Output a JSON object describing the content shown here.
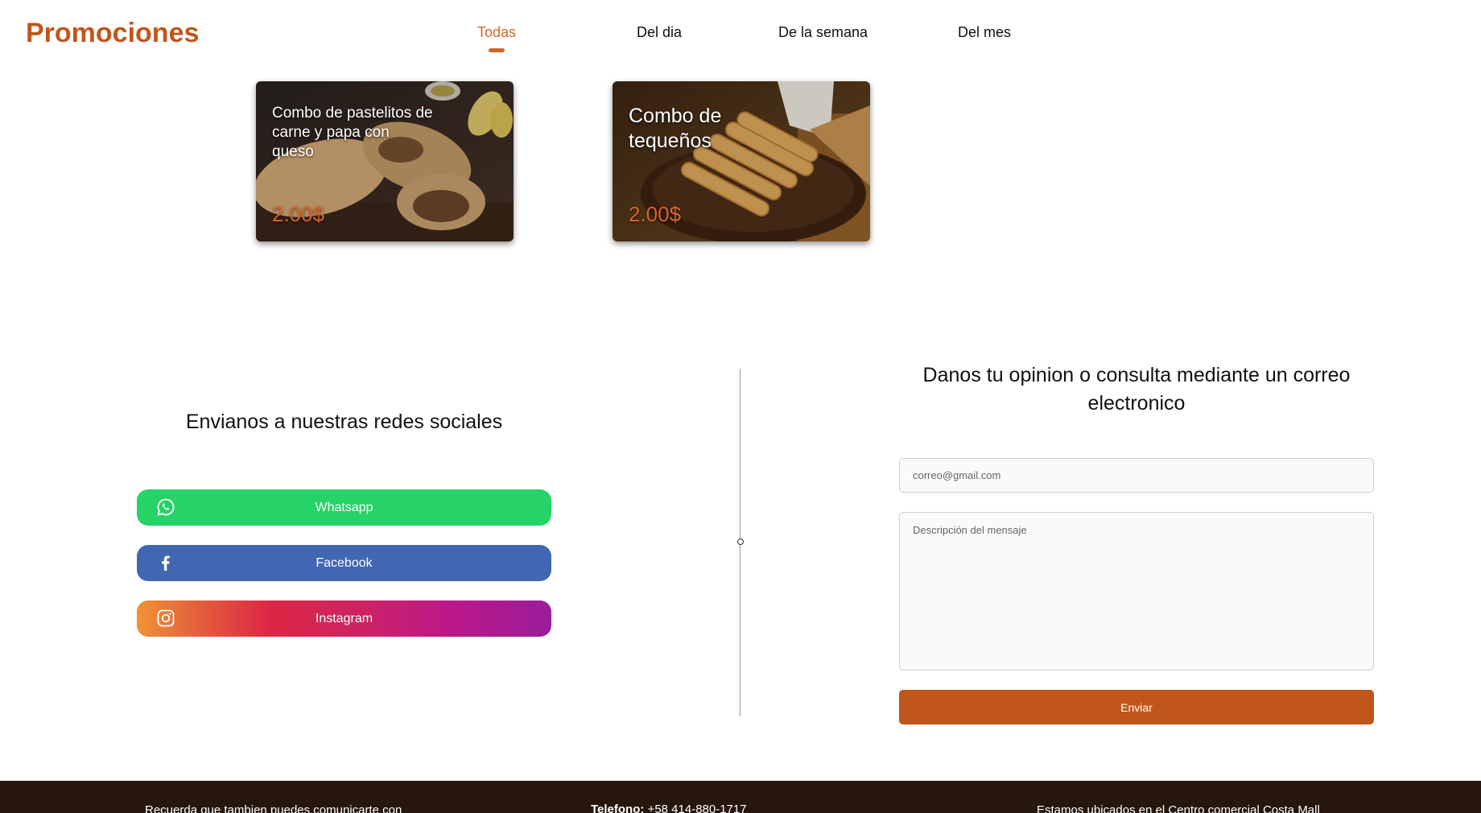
{
  "header": {
    "brand": "Promociones",
    "tabs": [
      {
        "label": "Todas",
        "active": true
      },
      {
        "label": "Del dia",
        "active": false
      },
      {
        "label": "De la semana",
        "active": false
      },
      {
        "label": "Del mes",
        "active": false
      }
    ]
  },
  "promotions": [
    {
      "title": "Combo de pastelitos de carne y papa con queso",
      "price": "2.00$"
    },
    {
      "title": "Combo de tequeños",
      "price": "2.00$"
    }
  ],
  "social": {
    "title": "Envianos a nuestras redes sociales",
    "buttons": [
      {
        "label": "Whatsapp",
        "icon": "whatsapp-icon",
        "color": "#25d366"
      },
      {
        "label": "Facebook",
        "icon": "facebook-icon",
        "color": "#4267b2"
      },
      {
        "label": "Instagram",
        "icon": "instagram-icon",
        "color": "gradient"
      }
    ]
  },
  "contact": {
    "title": "Danos tu opinion o consulta mediante un correo electronico",
    "email_placeholder": "correo@gmail.com",
    "message_placeholder": "Descripción del mensaje",
    "submit_label": "Enviar"
  },
  "footer": {
    "left_text": "Recuerda que tambien puedes comunicarte con",
    "phone_label": "Telefono:",
    "phone_value": "+58 414-880-1717",
    "location_text": "Estamos ubicados en el Centro comercial Costa Mall"
  },
  "colors": {
    "accent": "#c0561b",
    "tab_active": "#d0672a",
    "footer_bg": "#26160c"
  }
}
